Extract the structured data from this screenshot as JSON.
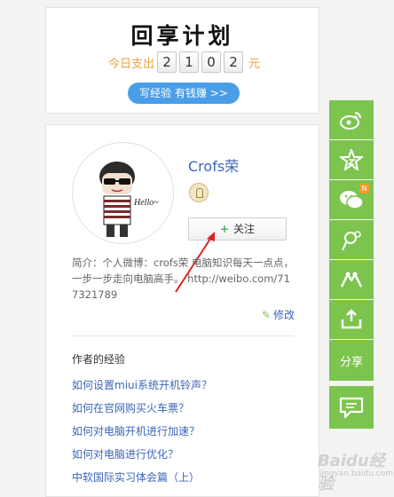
{
  "plan_card": {
    "title": "回享计划",
    "spend_label": "今日支出",
    "digits": [
      "2",
      "1",
      "0",
      "2"
    ],
    "unit": "元",
    "write_button": "写经验 有钱赚 >>"
  },
  "author": {
    "name": "Crofs荣",
    "follow_label": "关注",
    "intro": "简介：个人微博：crofs荣 电脑知识每天一点点，一步一步走向电脑高手。 http://weibo.com/717321789",
    "edit_label": "修改",
    "experience_title": "作者的经验",
    "experiences": [
      "如何设置miui系统开机铃声？",
      "如何在官网购买火车票？",
      "如何对电脑开机进行加速？",
      "如何对电脑进行优化？",
      "中软国际实习体会篇（上）"
    ]
  },
  "sidebar": {
    "badge_new": "N",
    "share_label": "分享",
    "accent": "#7cc44e"
  },
  "watermark": {
    "text": "Baidu经验",
    "sub": "jingyan.baidu.com"
  }
}
